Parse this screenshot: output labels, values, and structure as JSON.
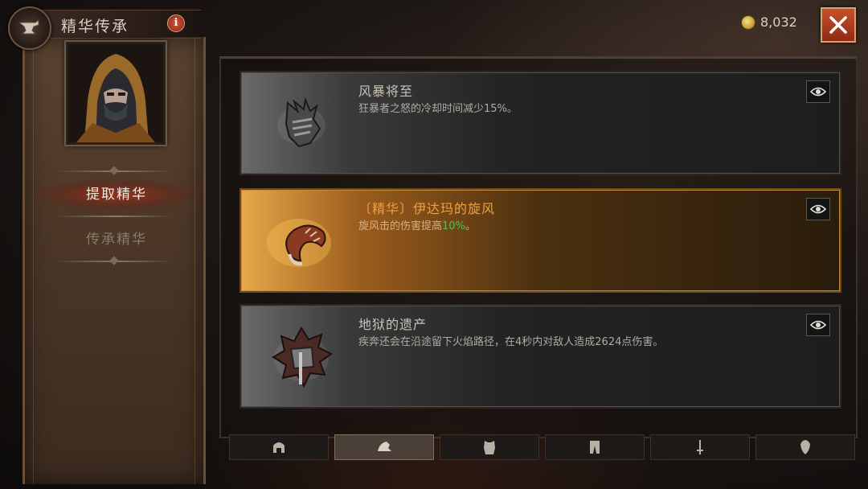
{
  "header": {
    "title": "精华传承",
    "info_icon": "i"
  },
  "sidebar": {
    "items": [
      {
        "label": "提取精华",
        "active": true
      },
      {
        "label": "传承精华",
        "active": false
      }
    ]
  },
  "currency": {
    "gold": "8,032",
    "icon": "gold-coin-icon"
  },
  "essences": [
    {
      "title": "风暴将至",
      "desc": "狂暴者之怒的冷却时间减少15%。",
      "icon": "gauntlet-icon",
      "selected": false
    },
    {
      "title": "〔精华〕伊达玛的旋风",
      "desc_pre": "旋风击的伤害提高",
      "desc_hl": "10%",
      "desc_post": "。",
      "icon": "horn-icon",
      "selected": true
    },
    {
      "title": "地狱的遗产",
      "desc": "疾奔还会在沿途留下火焰路径，在4秒内对敌人造成2624点伤害。",
      "icon": "spiked-shield-icon",
      "selected": false
    }
  ],
  "tabs": [
    {
      "name": "helm-icon",
      "active": false
    },
    {
      "name": "shoulder-icon",
      "active": true
    },
    {
      "name": "chest-icon",
      "active": false
    },
    {
      "name": "legs-icon",
      "active": false
    },
    {
      "name": "weapon-icon",
      "active": false
    },
    {
      "name": "offhand-icon",
      "active": false
    }
  ],
  "colors": {
    "accent_red": "#c9502e",
    "highlight_green": "#4fc44a",
    "gold_title": "#f0a040"
  }
}
